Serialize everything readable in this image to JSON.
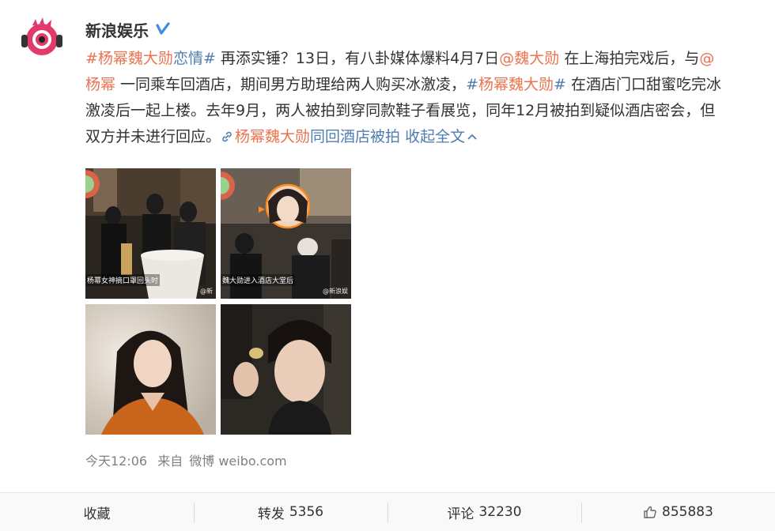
{
  "author": {
    "name": "新浪娱乐",
    "avatar_text": "新浪娱乐"
  },
  "post": {
    "line1": {
      "topic1_hash_open": "#",
      "topic1_name": "杨幂魏大勋",
      "topic1_suffix": "恋情",
      "topic1_hash_close": "#",
      "text1": " 再添实锤？13日，有八卦媒体爆料4月7日",
      "mention1": "@魏大勋",
      "text2": " 在上海拍完戏后，与",
      "mention2_at": "@"
    },
    "line2": {
      "mention2_name": "杨幂",
      "text1": " 一同乘车回酒店，期间男方助理给两人购买冰激凌，",
      "topic2_hash_open": "#",
      "topic2_name": "杨幂魏大勋",
      "topic2_hash_close": "#",
      "text2": " 在酒店门口甜蜜吃完冰"
    },
    "line3": {
      "text": "激凌后一起上楼。去年9月，两人被拍到穿同款鞋子看展览，同年12月被拍到疑似酒店密会，但"
    },
    "line4": {
      "text": "双方并未进行回应。",
      "link_name": "杨幂魏大勋",
      "link_suffix": "同回酒店被拍",
      "collapse": "收起全文"
    }
  },
  "photos": {
    "p1_caption": "杨幂女神摘口罩回头时",
    "p1_watermark": "@新",
    "p2_caption": "魏大勋进入酒店大堂后",
    "p2_watermark": "@新浪娱"
  },
  "meta": {
    "time": "今天12:06",
    "source_prefix": "来自",
    "source": "微博 weibo.com"
  },
  "actions": {
    "favorite_label": "收藏",
    "repost_label": "转发",
    "repost_count": "5356",
    "comment_label": "评论",
    "comment_count": "32230",
    "like_count": "855883"
  },
  "colors": {
    "topic": "#eb7350",
    "link": "#507daf",
    "verified": "#3a8ee6",
    "meta": "#808080"
  },
  "icons": [
    "verified-icon",
    "chain-link-icon",
    "chevron-up-icon",
    "thumbs-up-icon"
  ]
}
